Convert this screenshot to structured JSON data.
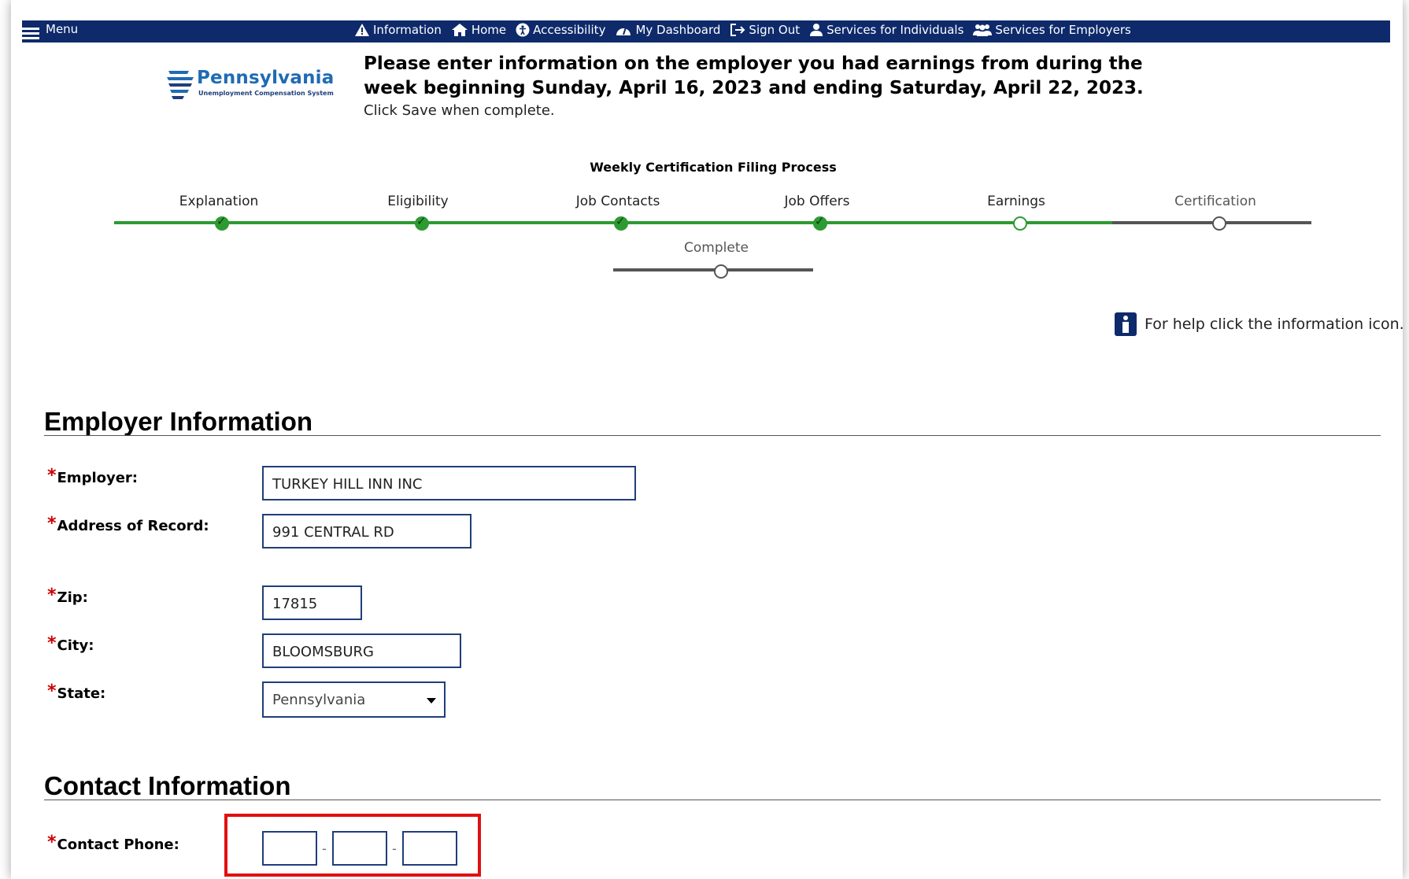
{
  "nav": {
    "menu_label": "Menu",
    "links": [
      {
        "label": "Information",
        "icon": "warning-icon"
      },
      {
        "label": "Home",
        "icon": "home-icon"
      },
      {
        "label": "Accessibility",
        "icon": "accessibility-icon"
      },
      {
        "label": "My Dashboard",
        "icon": "dashboard-icon"
      },
      {
        "label": "Sign Out",
        "icon": "sign-out-icon"
      },
      {
        "label": "Services for Individuals",
        "icon": "person-icon"
      },
      {
        "label": "Services for Employers",
        "icon": "group-icon"
      }
    ]
  },
  "logo": {
    "name": "Pennsylvania",
    "tagline": "Unemployment Compensation System",
    "color": "#1f6bb4"
  },
  "header": {
    "heading": "Please enter information on the employer you had earnings from during the week beginning Sunday, April 16, 2023 and ending Saturday, April 22, 2023.",
    "instruction": "Click Save when complete."
  },
  "tracker": {
    "title": "Weekly Certification Filing Process",
    "steps": [
      {
        "label": "Explanation",
        "status": "done"
      },
      {
        "label": "Eligibility",
        "status": "done"
      },
      {
        "label": "Job Contacts",
        "status": "done"
      },
      {
        "label": "Job Offers",
        "status": "done"
      },
      {
        "label": "Earnings",
        "status": "current"
      },
      {
        "label": "Certification",
        "status": "todo"
      },
      {
        "label": "Complete",
        "status": "todo"
      }
    ],
    "colors": {
      "done": "#2e9a32",
      "todo": "#555555"
    }
  },
  "help_text": "For help click the information icon.",
  "employer_section": {
    "title": "Employer Information",
    "fields": {
      "employer": {
        "label": "Employer:",
        "value": "TURKEY HILL INN INC"
      },
      "address": {
        "label": "Address of Record:",
        "value": "991 CENTRAL RD"
      },
      "zip": {
        "label": "Zip:",
        "value": "17815"
      },
      "city": {
        "label": "City:",
        "value": "BLOOMSBURG"
      },
      "state": {
        "label": "State:",
        "value": "Pennsylvania"
      }
    }
  },
  "contact_section": {
    "title": "Contact Information",
    "phone_label": "Contact Phone:",
    "phone_separator": "-",
    "highlight_color": "#e01010"
  },
  "required_marker": "*"
}
